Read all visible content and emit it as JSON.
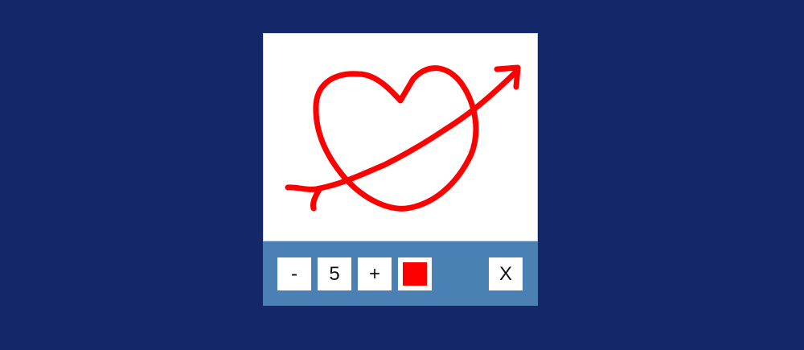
{
  "colors": {
    "background": "#132769",
    "toolbar": "#4a80b4",
    "canvas": "#ffffff",
    "stroke": "#ff0000"
  },
  "canvas": {
    "drawing": "heart-with-arrow",
    "stroke_color": "#ff0000"
  },
  "toolbar": {
    "decrease_label": "-",
    "brush_size": "5",
    "increase_label": "+",
    "color_swatch": "#ff0000",
    "close_label": "X"
  }
}
